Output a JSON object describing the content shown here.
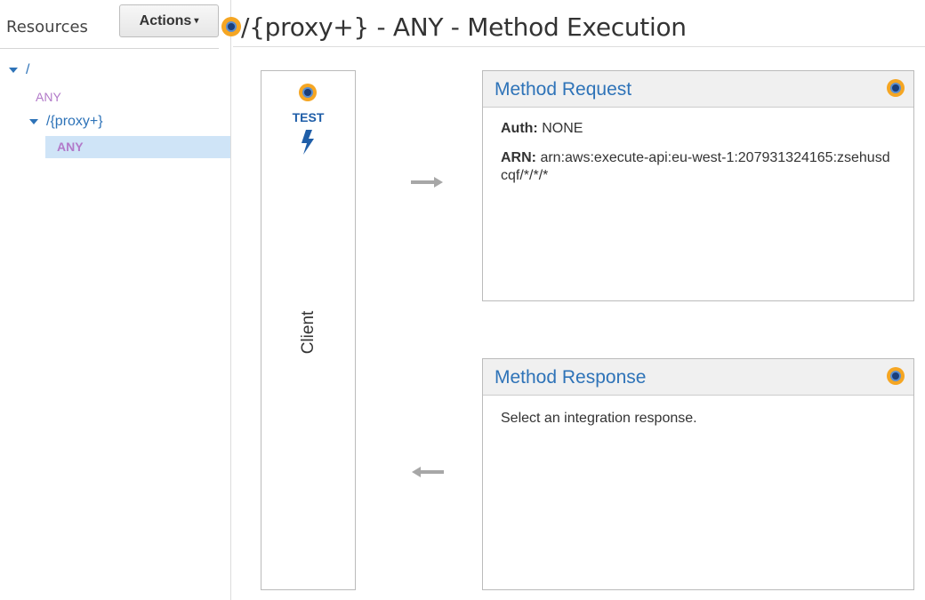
{
  "sidebar": {
    "title": "Resources",
    "actions_label": "Actions",
    "tree": {
      "root": "/",
      "root_method": "ANY",
      "child": "/{proxy+}",
      "child_method": "ANY"
    }
  },
  "header": {
    "title": "/{proxy+} - ANY - Method Execution"
  },
  "client": {
    "test_label": "TEST",
    "label": "Client"
  },
  "method_request": {
    "title": "Method Request",
    "auth_key": "Auth:",
    "auth_value": "NONE",
    "arn_key": "ARN:",
    "arn_value": "arn:aws:execute-api:eu-west-1:207931324165:zsehusdcqf/*/*/*"
  },
  "method_response": {
    "title": "Method Response",
    "text": "Select an integration response."
  },
  "icons": {
    "info_dot": "info-dot-icon",
    "bolt": "lightning-bolt-icon",
    "arrow_right": "arrow-right-icon",
    "arrow_left": "arrow-left-icon"
  },
  "colors": {
    "link_blue": "#2e73b8",
    "method_purple": "#b27ac9",
    "selected_bg": "#cfe4f7",
    "info_orange": "#f5a623"
  }
}
